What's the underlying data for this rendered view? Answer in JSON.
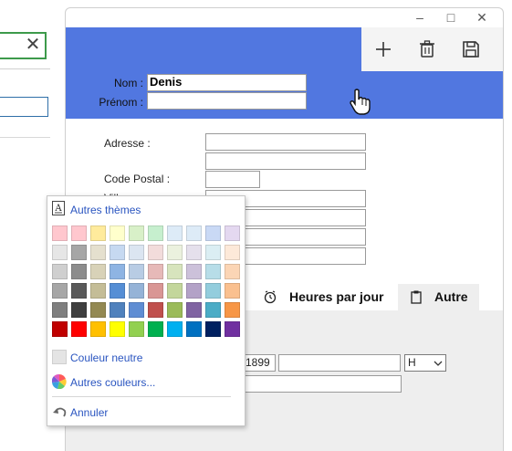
{
  "window_controls": {
    "minimize": "–",
    "maximize": "□",
    "close": "✕"
  },
  "form": {
    "nom_label": "Nom :",
    "nom_value": "Denis",
    "prenom_label": "Prénom :",
    "prenom_value": "",
    "adresse_label": "Adresse :",
    "code_postal_label": "Code Postal :",
    "ville_label_partial": "Vill"
  },
  "tabs": [
    {
      "label": "Heures par jour",
      "icon": "clock-icon"
    },
    {
      "label": "Autre",
      "icon": "clipboard-icon"
    }
  ],
  "lower": {
    "partial_value": "1899",
    "unit_select": "H"
  },
  "color_picker": {
    "themes_label": "Autres thèmes",
    "neutral_label": "Couleur neutre",
    "more_colors_label": "Autres couleurs...",
    "cancel_label": "Annuler",
    "theme_rows": [
      [
        "#ffffff",
        "#000000",
        "#eeece1",
        "#1f497d",
        "#4f81bd",
        "#c0504d",
        "#9bbb59",
        "#8064a2",
        "#4bacc6",
        "#f79646"
      ],
      [
        "#e6e6e6",
        "#a6a6a6",
        "#e5e0ce",
        "#c6d9f1",
        "#dbe5f1",
        "#f2dcdb",
        "#ebf1de",
        "#e5e0ec",
        "#dbeef3",
        "#fde9d9"
      ],
      [
        "#cfcfcf",
        "#8c8c8c",
        "#d8d2b8",
        "#8eb4e3",
        "#b8cce4",
        "#e6b9b8",
        "#d7e4bd",
        "#ccc1da",
        "#b7dde8",
        "#fbd5b5"
      ],
      [
        "#a6a6a6",
        "#595959",
        "#c4bd97",
        "#558ed5",
        "#95b3d7",
        "#d99694",
        "#c3d69b",
        "#b3a2c7",
        "#93cddd",
        "#fac08f"
      ],
      [
        "#7f7f7f",
        "#3f3f3f",
        "#938953",
        "#4f81bd",
        "#5f8dd3",
        "#c0504d",
        "#9bbb59",
        "#8064a2",
        "#4bacc6",
        "#f79646"
      ]
    ],
    "standard_row": [
      "#c00000",
      "#ff0000",
      "#ffc000",
      "#ffff00",
      "#92d050",
      "#00b050",
      "#00b0f0",
      "#0070c0",
      "#002060",
      "#7030a0"
    ],
    "pastel_row": [
      "#ffc7ce",
      "#ffc7ce",
      "#ffeb9c",
      "#ffffcc",
      "#d8f0c8",
      "#c6efce",
      "#ddebf7",
      "#ddebf7",
      "#c9d9f5",
      "#e4d8f0"
    ]
  }
}
